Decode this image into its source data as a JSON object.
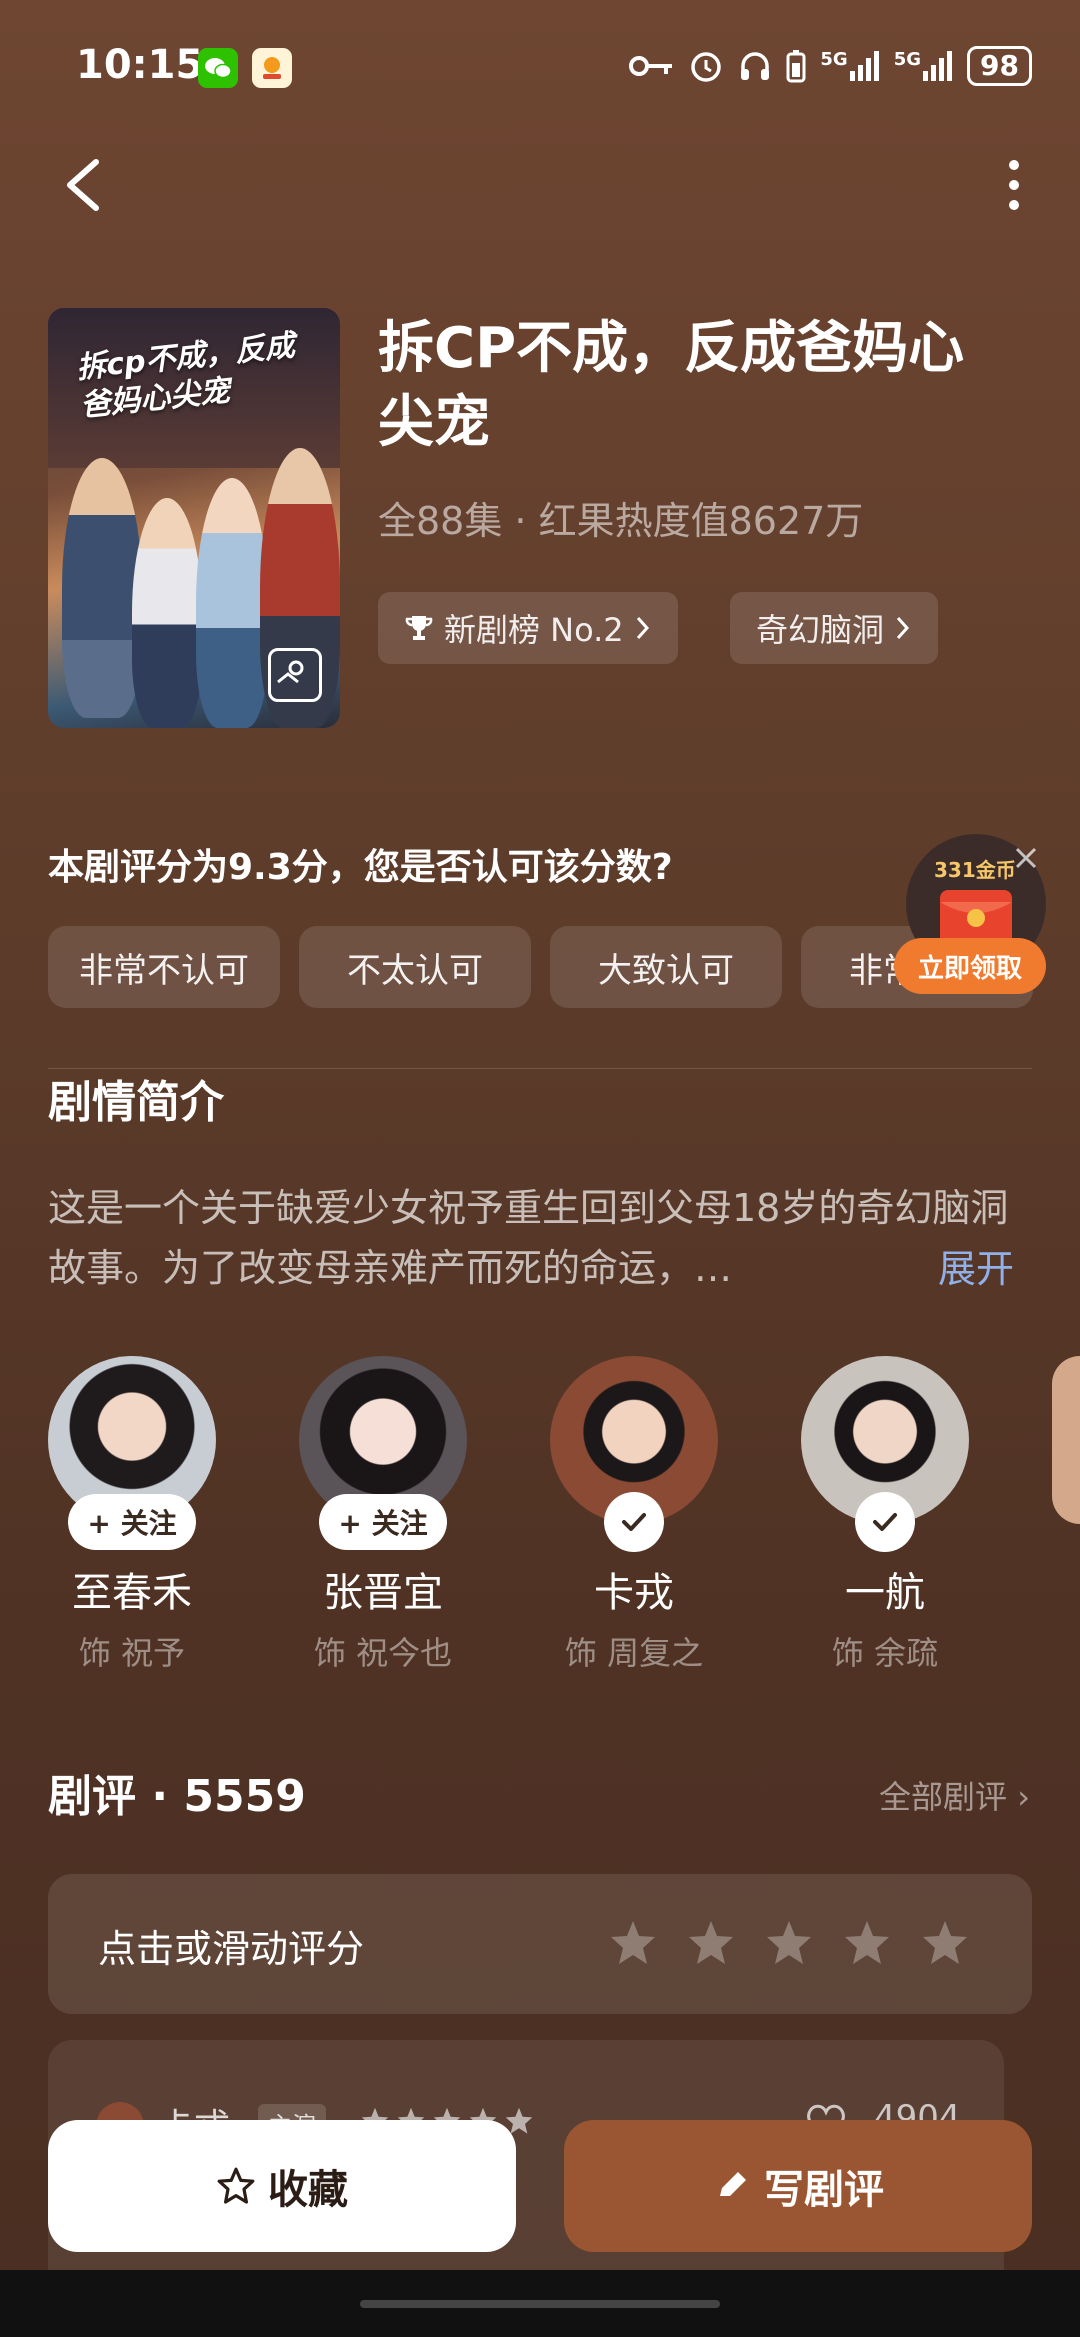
{
  "status_bar": {
    "time": "10:15",
    "signal_1": "5G",
    "signal_2": "5G",
    "battery": "98",
    "icons": [
      "wechat-icon",
      "app-icon",
      "key-icon",
      "alarm-icon",
      "headphones-icon",
      "battery-saver-icon"
    ]
  },
  "drama": {
    "title": "拆CP不成，反成爸妈心尖宠",
    "meta": "全88集 · 红果热度值8627万",
    "poster_title": "拆cp不成，反成爸妈心尖宠",
    "chip_rank": "新剧榜 No.2",
    "chip_genre": "奇幻脑洞"
  },
  "rating_question": {
    "text": "本剧评分为9.3分，您是否认可该分数?",
    "options": [
      "非常不认可",
      "不太认可",
      "大致认可",
      "非常认可"
    ]
  },
  "reward": {
    "coins": "331金币",
    "claim": "立即领取"
  },
  "synopsis": {
    "title": "剧情简介",
    "text": "这是一个关于缺爱少女祝予重生回到父母18岁的奇幻脑洞故事。为了改变母亲难产而死的命运，…",
    "expand": "展开"
  },
  "cast": [
    {
      "name": "至春禾",
      "role": "饰 祝予",
      "follow": "+ 关注"
    },
    {
      "name": "张晋宜",
      "role": "饰 祝今也",
      "follow": "+ 关注"
    },
    {
      "name": "卡戎",
      "role": "饰 周复之"
    },
    {
      "name": "一航",
      "role": "饰 余疏"
    }
  ],
  "reviews": {
    "header": "剧评 · 5559",
    "all": "全部剧评 ›",
    "rate_prompt": "点击或滑动评分",
    "first_user": "卡戎",
    "first_badge": "主演",
    "first_likes": "4904"
  },
  "bottom": {
    "favorite": "收藏",
    "write": "写剧评"
  },
  "colors": {
    "accent_button": "#9a5633",
    "link": "#8fb0ea",
    "reward_orange": "#f07a2e"
  }
}
